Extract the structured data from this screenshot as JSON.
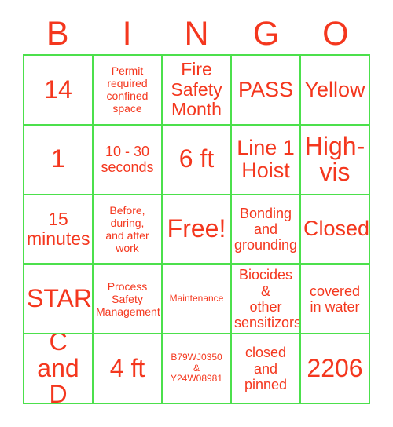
{
  "card": {
    "title": "BINGO Card",
    "accent_text_color": "#f4371e",
    "grid_line_color": "#4ce04c",
    "background_color": "#ffffff"
  },
  "header": {
    "letters": [
      {
        "label": "B"
      },
      {
        "label": "I"
      },
      {
        "label": "N"
      },
      {
        "label": "G"
      },
      {
        "label": "O"
      }
    ]
  },
  "grid": {
    "columns": 5,
    "rows": 5,
    "free_space": {
      "row": 2,
      "col": 2,
      "label": "Free!"
    },
    "cells": [
      {
        "text": "14",
        "size": "fs-xxl"
      },
      {
        "text": "Permit\nrequired\nconfined\nspace",
        "size": "fs-sm"
      },
      {
        "text": "Fire\nSafety\nMonth",
        "size": "fs-lg"
      },
      {
        "text": "PASS",
        "size": "fs-xl"
      },
      {
        "text": "Yellow",
        "size": "fs-xl"
      },
      {
        "text": "1",
        "size": "fs-xxl"
      },
      {
        "text": "10 - 30\nseconds",
        "size": "fs-md"
      },
      {
        "text": "6 ft",
        "size": "fs-xxl"
      },
      {
        "text": "Line 1\nHoist",
        "size": "fs-xl"
      },
      {
        "text": "High-\nvis",
        "size": "fs-xxl"
      },
      {
        "text": "15\nminutes",
        "size": "fs-lg"
      },
      {
        "text": "Before,\nduring,\nand after\nwork",
        "size": "fs-sm"
      },
      {
        "text": "Free!",
        "size": "fs-xxl"
      },
      {
        "text": "Bonding\nand\ngrounding",
        "size": "fs-md"
      },
      {
        "text": "Closed",
        "size": "fs-xl"
      },
      {
        "text": "STAR",
        "size": "fs-xxl"
      },
      {
        "text": "Process\nSafety\nManagement",
        "size": "fs-sm"
      },
      {
        "text": "Maintenance",
        "size": "fs-xs"
      },
      {
        "text": "Biocides &\nother\nsensitizors",
        "size": "fs-md"
      },
      {
        "text": "covered\nin water",
        "size": "fs-md"
      },
      {
        "text": "C and\nD",
        "size": "fs-xxl"
      },
      {
        "text": "4 ft",
        "size": "fs-xxl"
      },
      {
        "text": "B79WJ0350\n&\nY24W08981",
        "size": "fs-xs"
      },
      {
        "text": "closed\nand\npinned",
        "size": "fs-md"
      },
      {
        "text": "2206",
        "size": "fs-xxl"
      }
    ]
  }
}
